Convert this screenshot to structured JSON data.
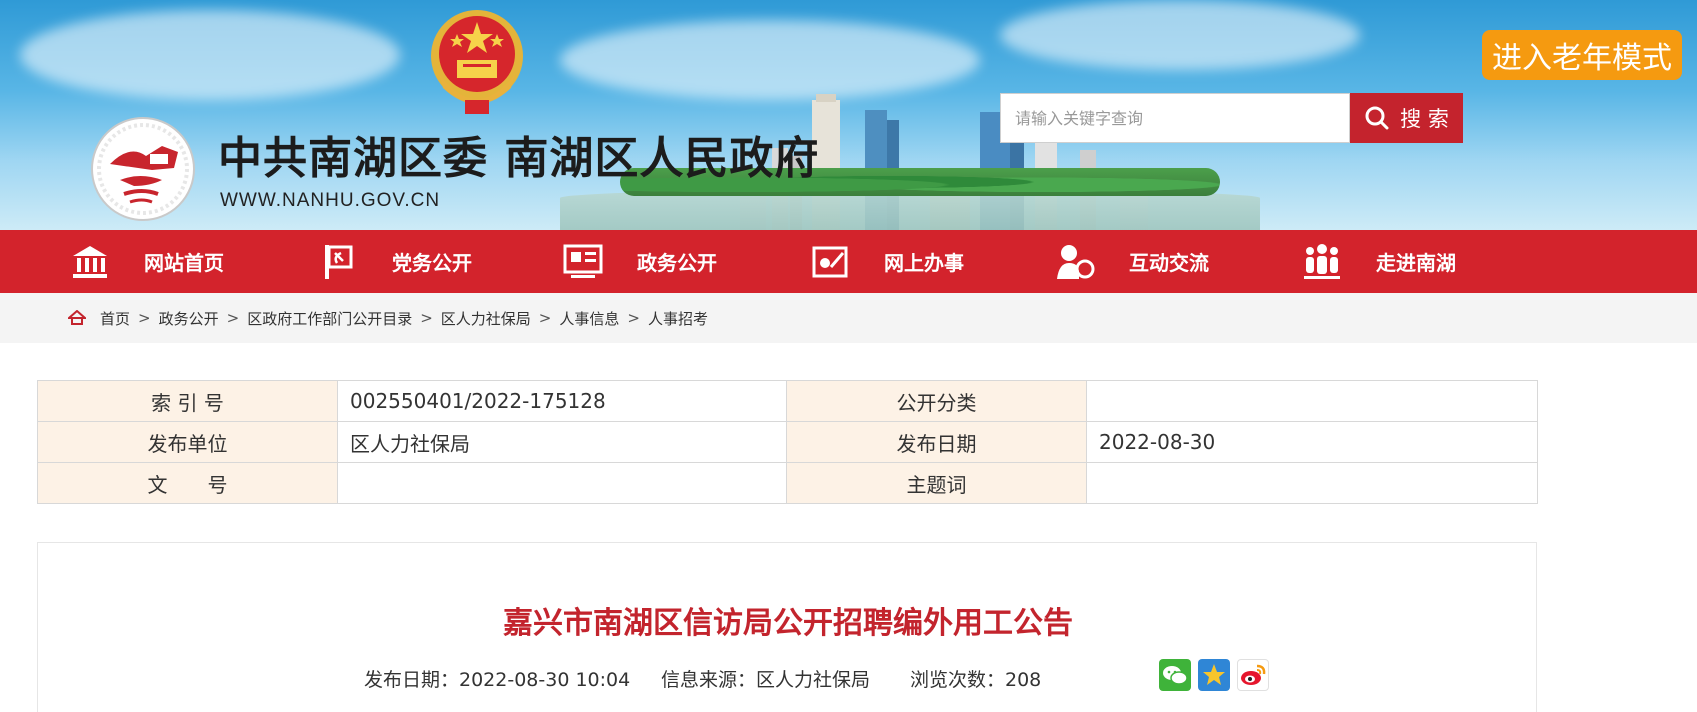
{
  "header": {
    "title": "中共南湖区委 南湖区人民政府",
    "url": "WWW.NANHU.GOV.CN",
    "elder_mode": "进入老年模式",
    "search": {
      "placeholder": "请输入关键字查询",
      "button": "搜 索"
    }
  },
  "nav": {
    "items": [
      {
        "label": "网站首页",
        "icon": "building-icon"
      },
      {
        "label": "党务公开",
        "icon": "party-flag-icon"
      },
      {
        "label": "政务公开",
        "icon": "document-icon"
      },
      {
        "label": "网上办事",
        "icon": "service-icon"
      },
      {
        "label": "互动交流",
        "icon": "user-chat-icon"
      },
      {
        "label": "走进南湖",
        "icon": "people-icon"
      }
    ]
  },
  "breadcrumb": [
    "首页",
    "政务公开",
    "区政府工作部门公开目录",
    "区人力社保局",
    "人事信息",
    "人事招考"
  ],
  "info": {
    "index_label": "索 引 号",
    "index_value": "002550401/2022-175128",
    "category_label": "公开分类",
    "category_value": "",
    "publisher_label": "发布单位",
    "publisher_value": "区人力社保局",
    "date_label": "发布日期",
    "date_value": "2022-08-30",
    "doc_label": "文　　号",
    "doc_value": "",
    "keyword_label": "主题词",
    "keyword_value": ""
  },
  "article": {
    "title": "嘉兴市南湖区信访局公开招聘编外用工公告",
    "publish": "发布日期：2022-08-30 10:04",
    "source": "信息来源：区人力社保局",
    "views": "浏览次数：208"
  },
  "colors": {
    "nav_red": "#d3232c",
    "title_red": "#c3242d",
    "elder_orange": "#f59a10"
  }
}
